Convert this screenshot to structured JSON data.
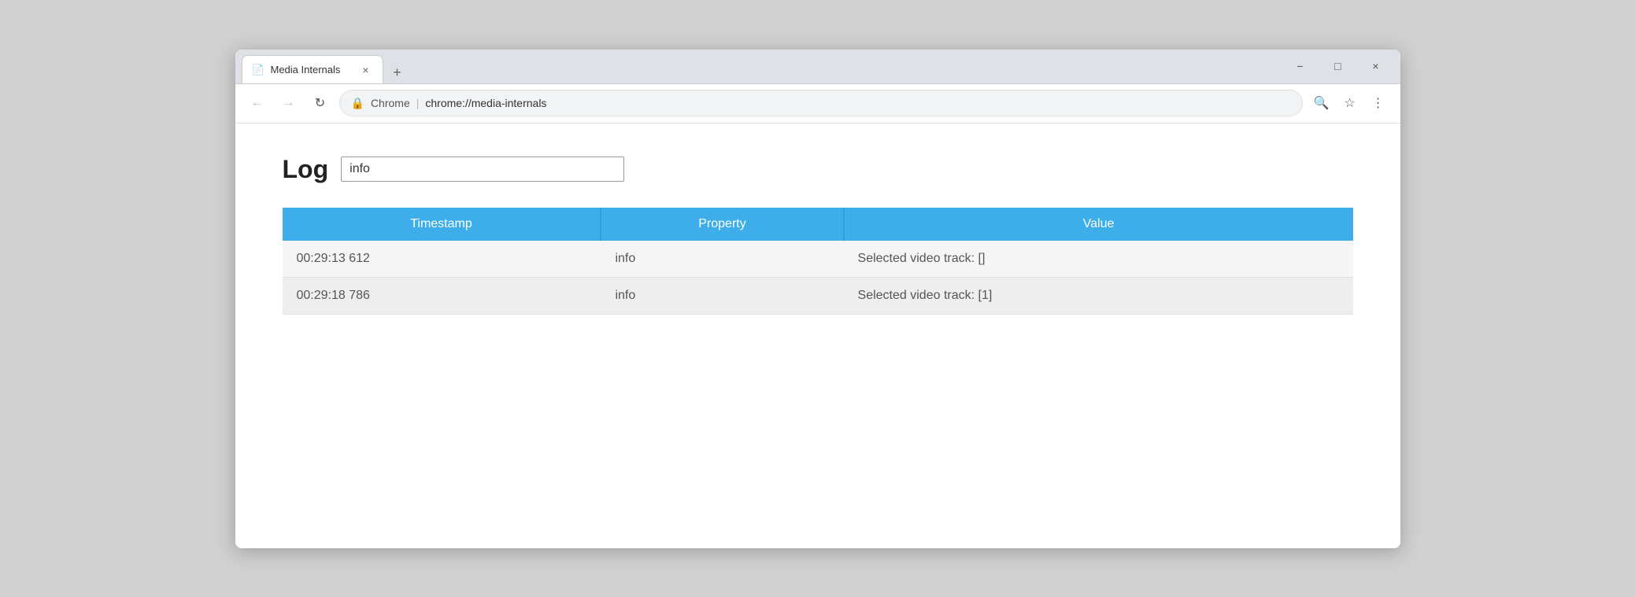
{
  "window": {
    "title": "Media Internals",
    "favicon": "📄"
  },
  "controls": {
    "minimize": "−",
    "maximize": "□",
    "close": "×"
  },
  "addressbar": {
    "back_icon": "←",
    "forward_icon": "→",
    "reload_icon": "↻",
    "security_icon": "🔒",
    "site_name": "Chrome",
    "url": "chrome://media-internals",
    "search_icon": "🔍",
    "star_icon": "☆",
    "menu_icon": "⋮"
  },
  "page": {
    "log_label": "Log",
    "log_input_value": "info",
    "log_input_placeholder": ""
  },
  "table": {
    "headers": [
      "Timestamp",
      "Property",
      "Value"
    ],
    "rows": [
      {
        "timestamp": "00:29:13 612",
        "property": "info",
        "value": "Selected video track: []"
      },
      {
        "timestamp": "00:29:18 786",
        "property": "info",
        "value": "Selected video track: [1]"
      }
    ]
  }
}
